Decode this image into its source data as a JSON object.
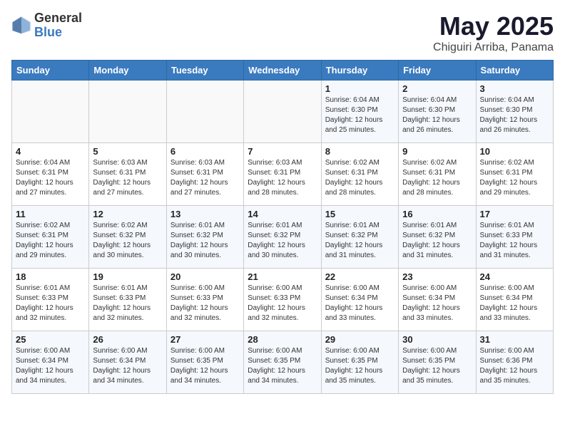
{
  "header": {
    "logo_general": "General",
    "logo_blue": "Blue",
    "title": "May 2025",
    "subtitle": "Chiguiri Arriba, Panama"
  },
  "days_of_week": [
    "Sunday",
    "Monday",
    "Tuesday",
    "Wednesday",
    "Thursday",
    "Friday",
    "Saturday"
  ],
  "weeks": [
    [
      {
        "day": "",
        "info": ""
      },
      {
        "day": "",
        "info": ""
      },
      {
        "day": "",
        "info": ""
      },
      {
        "day": "",
        "info": ""
      },
      {
        "day": "1",
        "info": "Sunrise: 6:04 AM\nSunset: 6:30 PM\nDaylight: 12 hours\nand 25 minutes."
      },
      {
        "day": "2",
        "info": "Sunrise: 6:04 AM\nSunset: 6:30 PM\nDaylight: 12 hours\nand 26 minutes."
      },
      {
        "day": "3",
        "info": "Sunrise: 6:04 AM\nSunset: 6:30 PM\nDaylight: 12 hours\nand 26 minutes."
      }
    ],
    [
      {
        "day": "4",
        "info": "Sunrise: 6:04 AM\nSunset: 6:31 PM\nDaylight: 12 hours\nand 27 minutes."
      },
      {
        "day": "5",
        "info": "Sunrise: 6:03 AM\nSunset: 6:31 PM\nDaylight: 12 hours\nand 27 minutes."
      },
      {
        "day": "6",
        "info": "Sunrise: 6:03 AM\nSunset: 6:31 PM\nDaylight: 12 hours\nand 27 minutes."
      },
      {
        "day": "7",
        "info": "Sunrise: 6:03 AM\nSunset: 6:31 PM\nDaylight: 12 hours\nand 28 minutes."
      },
      {
        "day": "8",
        "info": "Sunrise: 6:02 AM\nSunset: 6:31 PM\nDaylight: 12 hours\nand 28 minutes."
      },
      {
        "day": "9",
        "info": "Sunrise: 6:02 AM\nSunset: 6:31 PM\nDaylight: 12 hours\nand 28 minutes."
      },
      {
        "day": "10",
        "info": "Sunrise: 6:02 AM\nSunset: 6:31 PM\nDaylight: 12 hours\nand 29 minutes."
      }
    ],
    [
      {
        "day": "11",
        "info": "Sunrise: 6:02 AM\nSunset: 6:31 PM\nDaylight: 12 hours\nand 29 minutes."
      },
      {
        "day": "12",
        "info": "Sunrise: 6:02 AM\nSunset: 6:32 PM\nDaylight: 12 hours\nand 30 minutes."
      },
      {
        "day": "13",
        "info": "Sunrise: 6:01 AM\nSunset: 6:32 PM\nDaylight: 12 hours\nand 30 minutes."
      },
      {
        "day": "14",
        "info": "Sunrise: 6:01 AM\nSunset: 6:32 PM\nDaylight: 12 hours\nand 30 minutes."
      },
      {
        "day": "15",
        "info": "Sunrise: 6:01 AM\nSunset: 6:32 PM\nDaylight: 12 hours\nand 31 minutes."
      },
      {
        "day": "16",
        "info": "Sunrise: 6:01 AM\nSunset: 6:32 PM\nDaylight: 12 hours\nand 31 minutes."
      },
      {
        "day": "17",
        "info": "Sunrise: 6:01 AM\nSunset: 6:33 PM\nDaylight: 12 hours\nand 31 minutes."
      }
    ],
    [
      {
        "day": "18",
        "info": "Sunrise: 6:01 AM\nSunset: 6:33 PM\nDaylight: 12 hours\nand 32 minutes."
      },
      {
        "day": "19",
        "info": "Sunrise: 6:01 AM\nSunset: 6:33 PM\nDaylight: 12 hours\nand 32 minutes."
      },
      {
        "day": "20",
        "info": "Sunrise: 6:00 AM\nSunset: 6:33 PM\nDaylight: 12 hours\nand 32 minutes."
      },
      {
        "day": "21",
        "info": "Sunrise: 6:00 AM\nSunset: 6:33 PM\nDaylight: 12 hours\nand 32 minutes."
      },
      {
        "day": "22",
        "info": "Sunrise: 6:00 AM\nSunset: 6:34 PM\nDaylight: 12 hours\nand 33 minutes."
      },
      {
        "day": "23",
        "info": "Sunrise: 6:00 AM\nSunset: 6:34 PM\nDaylight: 12 hours\nand 33 minutes."
      },
      {
        "day": "24",
        "info": "Sunrise: 6:00 AM\nSunset: 6:34 PM\nDaylight: 12 hours\nand 33 minutes."
      }
    ],
    [
      {
        "day": "25",
        "info": "Sunrise: 6:00 AM\nSunset: 6:34 PM\nDaylight: 12 hours\nand 34 minutes."
      },
      {
        "day": "26",
        "info": "Sunrise: 6:00 AM\nSunset: 6:34 PM\nDaylight: 12 hours\nand 34 minutes."
      },
      {
        "day": "27",
        "info": "Sunrise: 6:00 AM\nSunset: 6:35 PM\nDaylight: 12 hours\nand 34 minutes."
      },
      {
        "day": "28",
        "info": "Sunrise: 6:00 AM\nSunset: 6:35 PM\nDaylight: 12 hours\nand 34 minutes."
      },
      {
        "day": "29",
        "info": "Sunrise: 6:00 AM\nSunset: 6:35 PM\nDaylight: 12 hours\nand 35 minutes."
      },
      {
        "day": "30",
        "info": "Sunrise: 6:00 AM\nSunset: 6:35 PM\nDaylight: 12 hours\nand 35 minutes."
      },
      {
        "day": "31",
        "info": "Sunrise: 6:00 AM\nSunset: 6:36 PM\nDaylight: 12 hours\nand 35 minutes."
      }
    ]
  ]
}
